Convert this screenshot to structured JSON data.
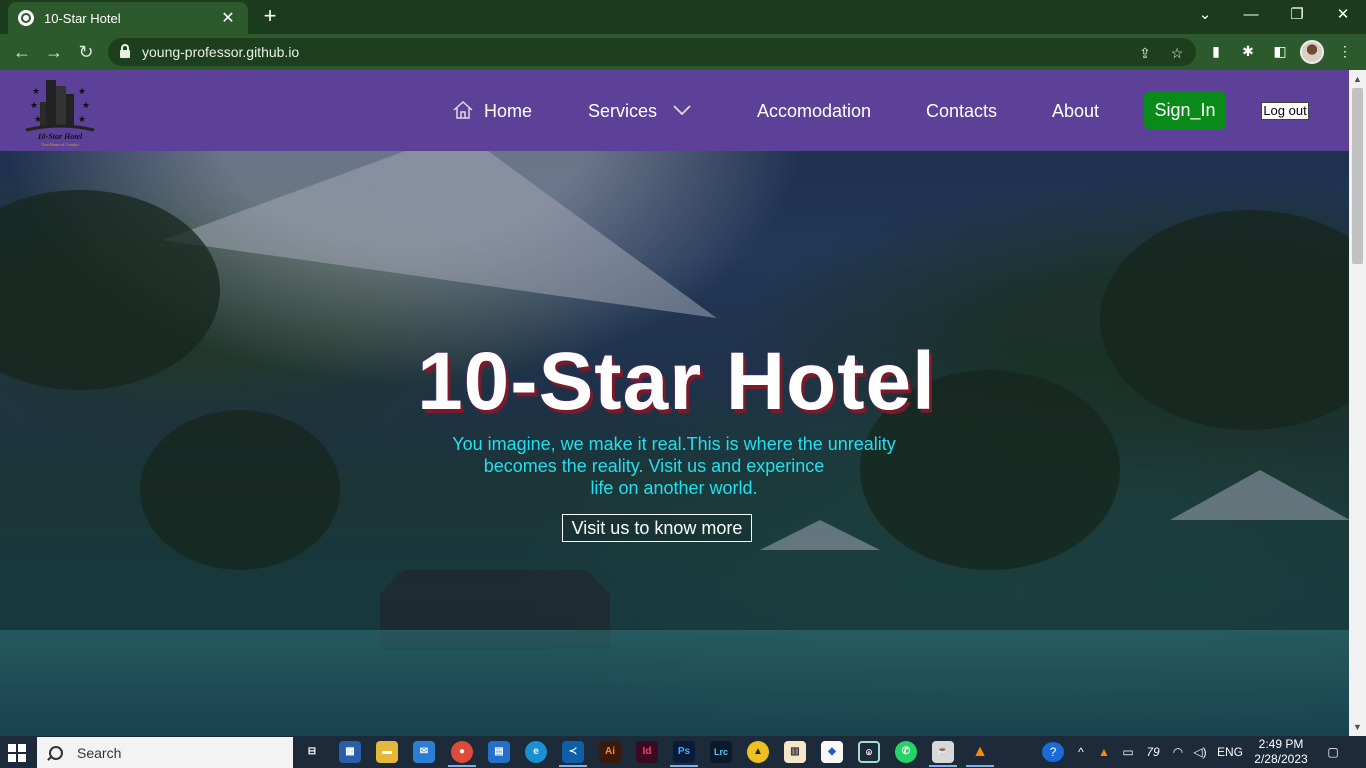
{
  "browser": {
    "tab_title": "10-Star Hotel",
    "tab_close": "✕",
    "new_tab": "+",
    "url": "young-professor.github.io",
    "minimize": "—",
    "restore": "❐",
    "close": "✕",
    "tab_search": "⌄"
  },
  "site": {
    "nav": {
      "home": "Home",
      "services": "Services",
      "accomodation": "Accomodation",
      "contacts": "Contacts",
      "about": "About",
      "sign_in": "Sign_In",
      "log_out": "Log out"
    },
    "logo_text": "10-Star Hotel",
    "logo_tagline": "Your Home of Comfort",
    "hero": {
      "title": "10-Star Hotel",
      "line1": "You imagine, we make it real.This is where the unreality",
      "line2": "becomes the reality. Visit us and experince",
      "line3": "life on another world.",
      "cta": "Visit us to know more"
    },
    "colors": {
      "nav_bg": "#5d4198",
      "signin_bg": "#0a8a18",
      "hero_text": "#1fe0f0"
    }
  },
  "taskbar": {
    "search_label": "Search",
    "apps": [
      "Ai",
      "Id",
      "Ps",
      "Lrc"
    ],
    "tray_temp": "79",
    "language": "ENG",
    "time": "2:49 PM",
    "date": "2/28/2023"
  }
}
